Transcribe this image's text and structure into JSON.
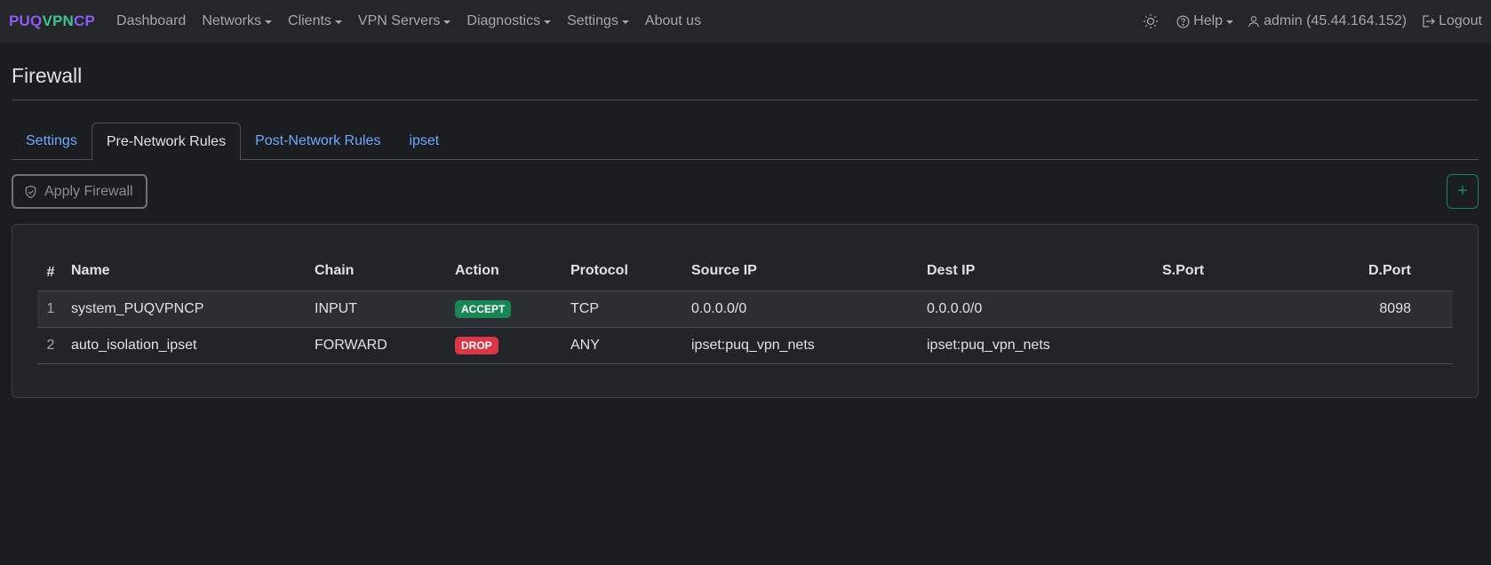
{
  "brand": {
    "part1": "PUQ",
    "part2": "VPN",
    "part3": "CP"
  },
  "nav": {
    "dashboard": "Dashboard",
    "networks": "Networks",
    "clients": "Clients",
    "vpn_servers": "VPN Servers",
    "diagnostics": "Diagnostics",
    "settings": "Settings",
    "about": "About us",
    "help": "Help",
    "user": "admin (45.44.164.152)",
    "logout": "Logout"
  },
  "page": {
    "title": "Firewall"
  },
  "tabs": [
    "Settings",
    "Pre-Network Rules",
    "Post-Network Rules",
    "ipset"
  ],
  "toolbar": {
    "apply_label": "Apply Firewall",
    "add_label": "+"
  },
  "table": {
    "headers": [
      "#",
      "Name",
      "Chain",
      "Action",
      "Protocol",
      "Source IP",
      "Dest IP",
      "S.Port",
      "D.Port"
    ],
    "rows": [
      {
        "num": "1",
        "name": "system_PUQVPNCP",
        "chain": "INPUT",
        "action": "ACCEPT",
        "protocol": "TCP",
        "source": "0.0.0.0/0",
        "dest": "0.0.0.0/0",
        "sport": "",
        "dport": "8098"
      },
      {
        "num": "2",
        "name": "auto_isolation_ipset",
        "chain": "FORWARD",
        "action": "DROP",
        "protocol": "ANY",
        "source": "ipset:puq_vpn_nets",
        "dest": "ipset:puq_vpn_nets",
        "sport": "",
        "dport": ""
      }
    ]
  },
  "colors": {
    "accept": "#198754",
    "drop": "#dc3545",
    "link": "#6ea8fe",
    "brand_purple": "#8c5cf5",
    "brand_green": "#3cc48e"
  }
}
